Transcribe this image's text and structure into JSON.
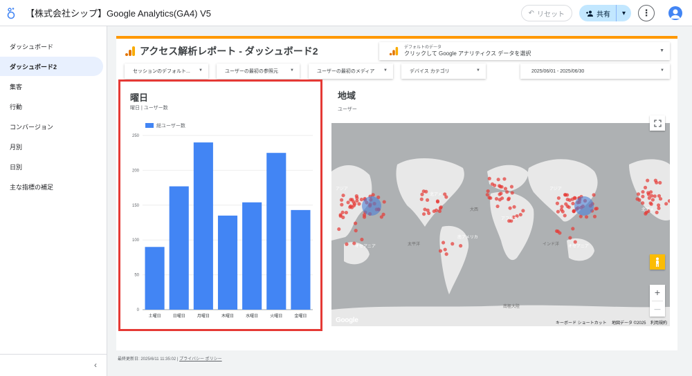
{
  "app": {
    "title": "【株式会社シップ】Google Analytics(GA4) V5"
  },
  "toolbar": {
    "reset_label": "リセット",
    "share_label": "共有"
  },
  "sidebar": {
    "items": [
      {
        "label": "ダッシュボード"
      },
      {
        "label": "ダッシュボード2"
      },
      {
        "label": "集客"
      },
      {
        "label": "行動"
      },
      {
        "label": "コンバージョン"
      },
      {
        "label": "月別"
      },
      {
        "label": "日別"
      },
      {
        "label": "主な指標の補足"
      }
    ],
    "active_index": 1,
    "collapse_label": "‹"
  },
  "report": {
    "title": "アクセス解析レポート - ダッシュボード2",
    "datasource_label": "デフォルトのデータ",
    "datasource_value": "クリックして Google アナリティクス データを選択",
    "filters": [
      {
        "label": "セッションのデフォルト..."
      },
      {
        "label": "ユーザーの最初の参照元"
      },
      {
        "label": "ユーザーの最初のメディア"
      },
      {
        "label": "デバイス カテゴリ"
      }
    ],
    "date_range": "2025/06/01 - 2025/06/30"
  },
  "chart_panel": {
    "title": "曜日",
    "subtitle": "曜日 | ユーザー数"
  },
  "chart_data": {
    "type": "bar",
    "categories": [
      "土曜日",
      "日曜日",
      "月曜日",
      "木曜日",
      "水曜日",
      "火曜日",
      "金曜日"
    ],
    "series": [
      {
        "name": "総ユーザー数",
        "values": [
          90,
          177,
          240,
          135,
          154,
          225,
          143
        ]
      }
    ],
    "ylim": [
      0,
      250
    ],
    "yticks": [
      0,
      50,
      100,
      150,
      200,
      250
    ],
    "legend": "top-left",
    "grid": true,
    "bar_color": "#4285f4"
  },
  "map_panel": {
    "title": "地域",
    "subtitle": "ユーザー",
    "labels": {
      "asia_left": "アジア",
      "asia_right": "アジア",
      "north_america": "北アメ",
      "africa": "アフリカ",
      "south_america": "南アメリカ",
      "oceania_left": "オセアニア",
      "oceania_right": "オセアニア",
      "europe_right": "北アメ",
      "antarctica": "南極大陸",
      "atlantic": "大西",
      "pacific": "太平洋",
      "indian": "インド洋"
    },
    "footer_shortcuts": "キーボード ショートカット",
    "footer_mapdata": "地図データ ©2025",
    "footer_terms": "利用規約",
    "google_logo": "Google",
    "zoom_in": "+",
    "zoom_out": "—"
  },
  "footer": {
    "updated": "最終更新日: 2025/6/11 11:35:02",
    "privacy": "プライバシー ポリシー"
  },
  "colors": {
    "accent": "#ff9800",
    "bar": "#4285f4",
    "highlight_border": "#e53935",
    "map_dots": "#e53935"
  }
}
